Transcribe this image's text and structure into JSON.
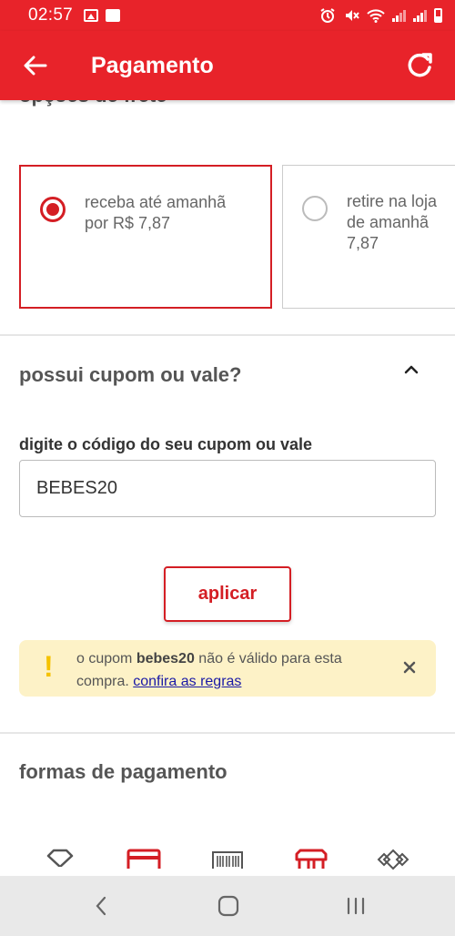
{
  "status_bar": {
    "time": "02:57"
  },
  "app_bar": {
    "title": "Pagamento"
  },
  "shipping": {
    "section_title": "opções de frete",
    "options": [
      {
        "text": "receba até amanhã\npor R$ 7,87",
        "selected": true
      },
      {
        "text": "retire na loja\nde amanhã\n7,87",
        "selected": false
      }
    ]
  },
  "coupon": {
    "title": "possui cupom ou vale?",
    "field_label": "digite o código do seu cupom ou vale",
    "input_value": "BEBES20",
    "apply_label": "aplicar",
    "alert": {
      "prefix": "o cupom ",
      "code": "bebes20",
      "suffix": " não é válido para esta compra. ",
      "link": "confira as regras"
    }
  },
  "payment": {
    "title": "formas de pagamento",
    "methods": [
      "diamond-icon",
      "credit-card-icon",
      "barcode-icon",
      "store-icon",
      "gift-card-icon"
    ]
  },
  "colors": {
    "brand": "#e8232a",
    "accent": "#d41e24",
    "alert_bg": "#fdf2c7",
    "alert_icon": "#f5c200",
    "link": "#1a1aa6"
  }
}
